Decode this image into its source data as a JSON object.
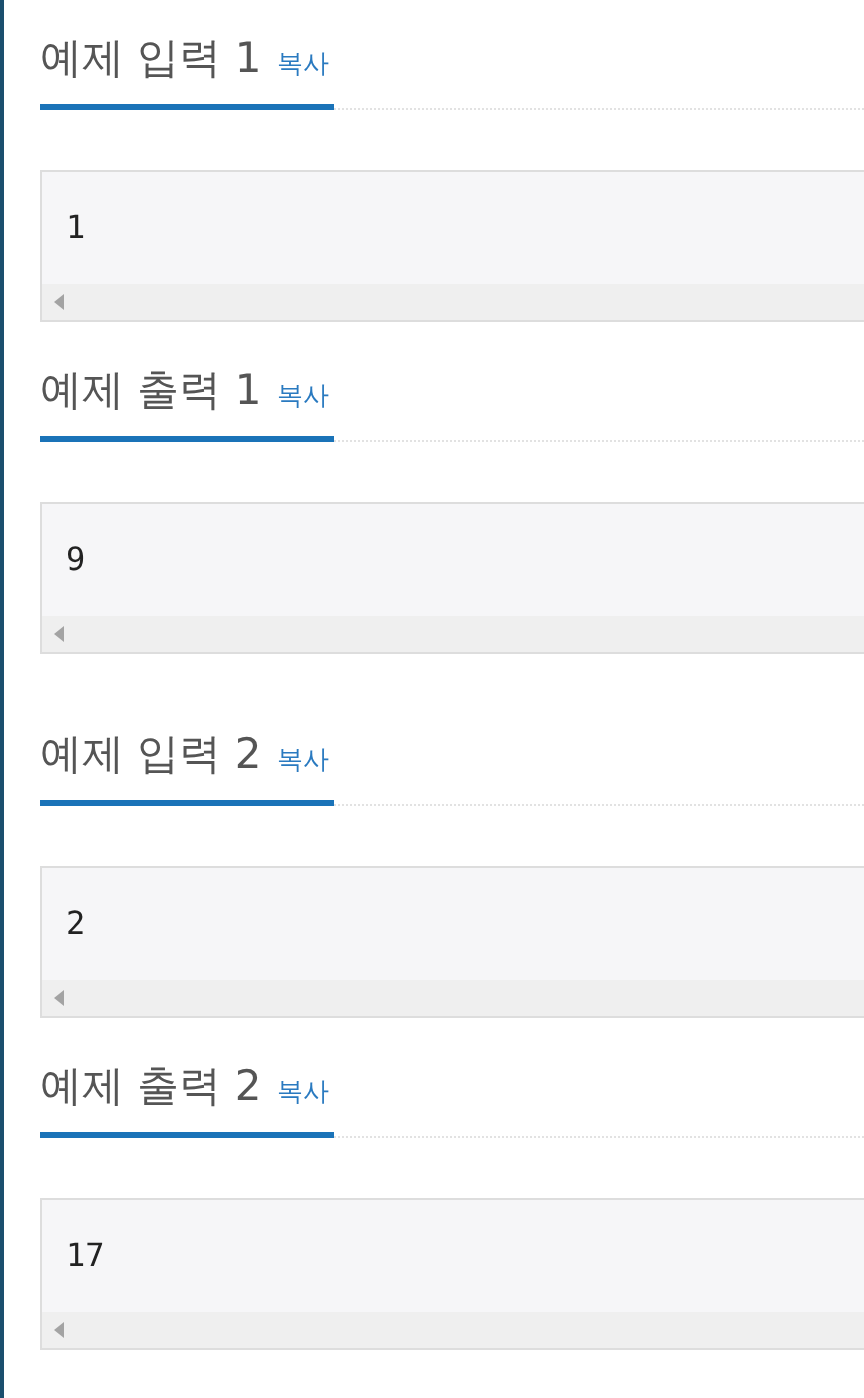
{
  "examples": [
    {
      "title": "예제 입력 1",
      "copy_label": "복사",
      "content": "1"
    },
    {
      "title": "예제 출력 1",
      "copy_label": "복사",
      "content": "9"
    },
    {
      "title": "예제 입력 2",
      "copy_label": "복사",
      "content": "2"
    },
    {
      "title": "예제 출력 2",
      "copy_label": "복사",
      "content": "17"
    }
  ]
}
